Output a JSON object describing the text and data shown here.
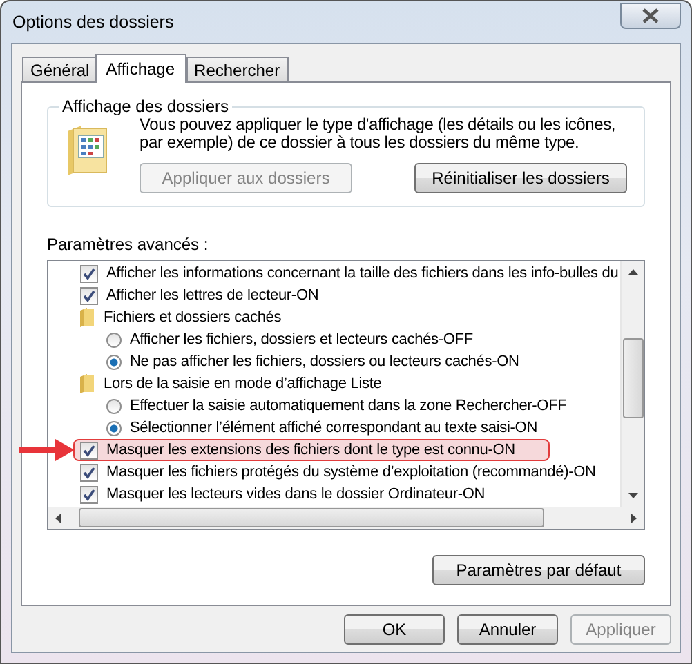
{
  "window": {
    "title": "Options des dossiers"
  },
  "tabs": [
    {
      "label": "Général",
      "selected": false
    },
    {
      "label": "Affichage",
      "selected": true
    },
    {
      "label": "Rechercher",
      "selected": false
    }
  ],
  "folder_views": {
    "title": "Affichage des dossiers",
    "description": "Vous pouvez appliquer le type d'affichage (les détails ou les icônes, par exemple) de ce dossier à tous les dossiers du même type.",
    "buttons": [
      {
        "label": "Appliquer aux dossiers",
        "disabled": true
      },
      {
        "label": "Réinitialiser les dossiers",
        "disabled": false
      }
    ]
  },
  "advanced": {
    "label": "Paramètres avancés :",
    "items": [
      {
        "kind": "checkbox",
        "label": "Afficher les informations concernant la taille des fichiers dans les info-bulles du",
        "checked": true,
        "highlighted": false
      },
      {
        "kind": "checkbox",
        "label": "Afficher les lettres de lecteur-ON",
        "checked": true,
        "highlighted": false
      },
      {
        "kind": "folder",
        "label": "Fichiers et dossiers cachés",
        "children": [
          {
            "kind": "radio",
            "label": "Afficher les fichiers, dossiers et lecteurs cachés-OFF",
            "selected": false
          },
          {
            "kind": "radio",
            "label": "Ne pas afficher les fichiers, dossiers ou lecteurs cachés-ON",
            "selected": true
          }
        ]
      },
      {
        "kind": "folder",
        "label": "Lors de la saisie en mode d’affichage Liste",
        "children": [
          {
            "kind": "radio",
            "label": "Effectuer la saisie automatiquement dans la zone Rechercher-OFF",
            "selected": false
          },
          {
            "kind": "radio",
            "label": "Sélectionner l’élément affiché correspondant au texte saisi-ON",
            "selected": true
          }
        ]
      },
      {
        "kind": "checkbox",
        "label": "Masquer les extensions des fichiers dont le type est connu-ON",
        "checked": true,
        "highlighted": true
      },
      {
        "kind": "checkbox",
        "label": "Masquer les fichiers protégés du système d’exploitation (recommandé)-ON",
        "checked": true,
        "highlighted": false
      },
      {
        "kind": "checkbox",
        "label": "Masquer les lecteurs vides dans le dossier Ordinateur-ON",
        "checked": true,
        "highlighted": false
      }
    ],
    "defaults_button": "Paramètres par défaut"
  },
  "buttons": [
    {
      "label": "OK",
      "disabled": false
    },
    {
      "label": "Annuler",
      "disabled": false
    },
    {
      "label": "Appliquer",
      "disabled": true
    }
  ]
}
